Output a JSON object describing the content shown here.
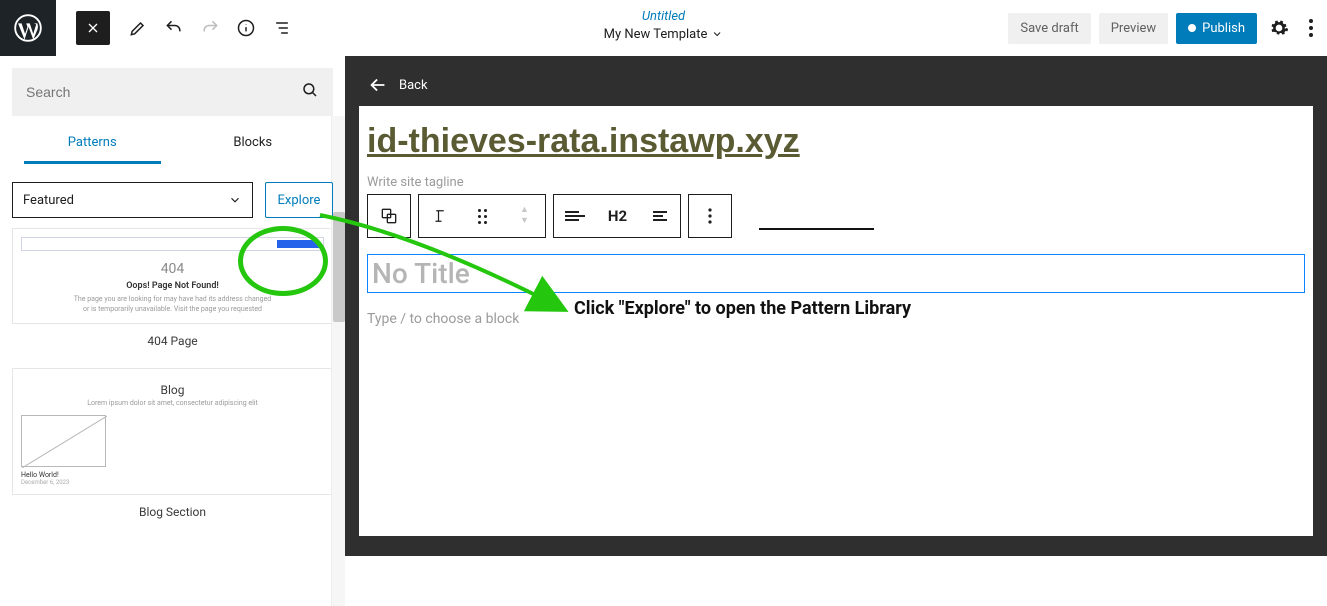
{
  "topbar": {
    "doc_title": "Untitled",
    "template_name": "My New Template",
    "save_draft": "Save draft",
    "preview": "Preview",
    "publish": "Publish"
  },
  "sidebar": {
    "search_placeholder": "Search",
    "tabs": {
      "patterns": "Patterns",
      "blocks": "Blocks"
    },
    "filter": {
      "selected": "Featured",
      "explore": "Explore"
    },
    "cards": [
      {
        "caption": "404 Page",
        "thumb": {
          "code": "404",
          "headline": "Oops! Page Not Found!",
          "line1": "The page you are looking for may have had its address changed",
          "line2": "or is temporarily unavailable. Visit the page you requested"
        }
      },
      {
        "caption": "Blog Section",
        "thumb": {
          "title": "Blog",
          "sub": "Lorem ipsum dolor sit amet, consectetur adipiscing elit",
          "hello": "Hello World!",
          "date": "December 6, 2023"
        }
      }
    ]
  },
  "canvas": {
    "back": "Back",
    "site_title": "id-thieves-rata.instawp.xyz",
    "tagline_placeholder": "Write site tagline",
    "heading_tool": "H2",
    "no_title": "No Title",
    "block_chooser": "Type / to choose a block"
  },
  "annotation": {
    "text": "Click \"Explore\" to open the Pattern Library"
  }
}
